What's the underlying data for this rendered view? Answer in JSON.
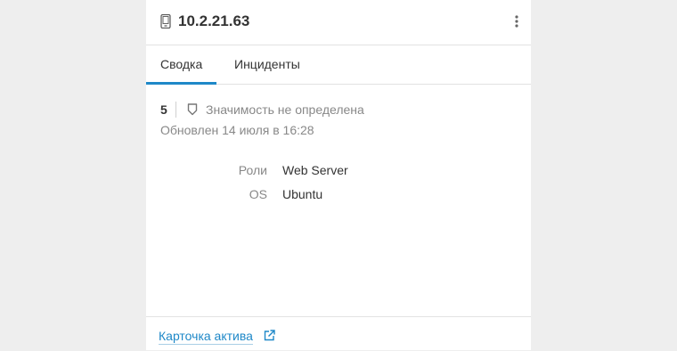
{
  "header": {
    "title": "10.2.21.63",
    "device_icon": "mobile-device-icon",
    "menu_icon": "kebab-menu-icon"
  },
  "tabs": [
    {
      "label": "Сводка",
      "active": true
    },
    {
      "label": "Инциденты",
      "active": false
    }
  ],
  "summary": {
    "score": "5",
    "severity_icon": "shield-icon",
    "severity_text": "Значимость не определена",
    "updated": "Обновлен 14 июля в 16:28"
  },
  "properties": [
    {
      "label": "Роли",
      "value": "Web Server"
    },
    {
      "label": "OS",
      "value": "Ubuntu"
    }
  ],
  "footer": {
    "link_label": "Карточка актива",
    "link_icon": "external-link-icon"
  },
  "colors": {
    "accent": "#1e88c8",
    "text": "#333333",
    "muted": "#888888",
    "background": "#eeeeee"
  }
}
